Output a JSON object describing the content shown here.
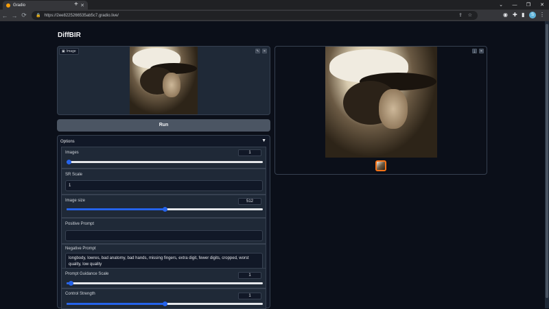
{
  "browser": {
    "tab_title": "Gradio",
    "tab_close": "✕",
    "new_tab": "+",
    "url": "https://2ee8225266535ab5c7.gradio.live/",
    "profile_initial": "S",
    "window_controls": [
      "⌄",
      "—",
      "❐",
      "✕"
    ]
  },
  "app": {
    "title": "DiffBIR",
    "input_label": "Image",
    "run_label": "Run",
    "options_label": "Options",
    "fields": {
      "images": {
        "label": "Images",
        "value": "1",
        "fraction": 0.0
      },
      "sr_scale": {
        "label": "SR Scale",
        "value": "1"
      },
      "image_size": {
        "label": "Image size",
        "value": "512",
        "fraction": 0.5
      },
      "positive_prompt": {
        "label": "Positive Prompt",
        "value": ""
      },
      "negative_prompt": {
        "label": "Negative Prompt",
        "value": "longbody, lowres, bad anatomy, bad hands, missing fingers, extra digit, fewer digits, cropped, worst quality, low quality"
      },
      "guidance_scale": {
        "label": "Prompt Guidance Scale",
        "value": "1",
        "fraction": 0.02
      },
      "control_strength": {
        "label": "Control Strength",
        "value": "1",
        "fraction": 0.5
      }
    }
  },
  "colors": {
    "accent": "#2563eb",
    "thumb_border": "#f97316",
    "bg": "#0b0f19"
  }
}
